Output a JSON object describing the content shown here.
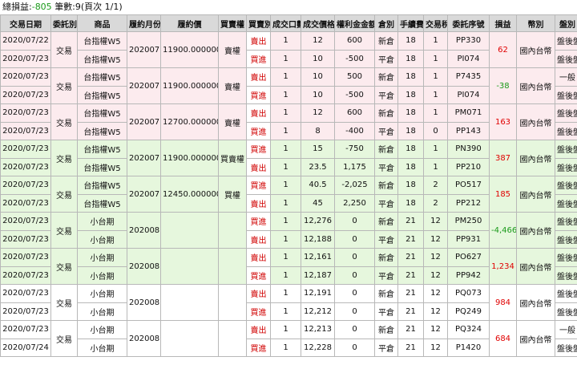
{
  "summary": {
    "pl_label": "總損益:",
    "pl_value": "-805",
    "count_label": "筆數:9(頁次 1/1)"
  },
  "headers": [
    "交易日期",
    "委託別",
    "商品",
    "履約月份",
    "履約價",
    "買賣權",
    "買賣別",
    "成交口數",
    "成交價格",
    "權利金金額",
    "倉別",
    "手續費",
    "交易稅",
    "委託序號",
    "損益",
    "幣別",
    "盤別"
  ],
  "groups": [
    {
      "color": "pink",
      "type": "交易",
      "month": "202007",
      "strike": "11900.000000",
      "cp": "賣權",
      "pl": "62",
      "pl_sign": "pos",
      "currency": "國內台幣",
      "rows": [
        {
          "date": "2020/07/22",
          "product": "台指權W5",
          "bs": "賣出",
          "qty": "1",
          "price": "12",
          "amount": "600",
          "pos": "新倉",
          "fee": "18",
          "tax": "1",
          "order": "PP330",
          "session": "盤後盤"
        },
        {
          "date": "2020/07/23",
          "product": "台指權W5",
          "bs": "買進",
          "qty": "1",
          "price": "10",
          "amount": "-500",
          "pos": "平倉",
          "fee": "18",
          "tax": "1",
          "order": "PI074",
          "session": "盤後盤"
        }
      ]
    },
    {
      "color": "pink",
      "type": "交易",
      "month": "202007",
      "strike": "11900.000000",
      "cp": "賣權",
      "pl": "-38",
      "pl_sign": "neg",
      "currency": "國內台幣",
      "rows": [
        {
          "date": "2020/07/23",
          "product": "台指權W5",
          "bs": "賣出",
          "qty": "1",
          "price": "10",
          "amount": "500",
          "pos": "新倉",
          "fee": "18",
          "tax": "1",
          "order": "P7435",
          "session": "一般"
        },
        {
          "date": "2020/07/23",
          "product": "台指權W5",
          "bs": "買進",
          "qty": "1",
          "price": "10",
          "amount": "-500",
          "pos": "平倉",
          "fee": "18",
          "tax": "1",
          "order": "PI074",
          "session": "盤後盤"
        }
      ]
    },
    {
      "color": "pink",
      "type": "交易",
      "month": "202007",
      "strike": "12700.000000",
      "cp": "賣權",
      "pl": "163",
      "pl_sign": "pos",
      "currency": "國內台幣",
      "rows": [
        {
          "date": "2020/07/23",
          "product": "台指權W5",
          "bs": "賣出",
          "qty": "1",
          "price": "12",
          "amount": "600",
          "pos": "新倉",
          "fee": "18",
          "tax": "1",
          "order": "PM071",
          "session": "盤後盤"
        },
        {
          "date": "2020/07/23",
          "product": "台指權W5",
          "bs": "買進",
          "qty": "1",
          "price": "8",
          "amount": "-400",
          "pos": "平倉",
          "fee": "18",
          "tax": "0",
          "order": "PP143",
          "session": "盤後盤"
        }
      ]
    },
    {
      "color": "green",
      "type": "交易",
      "month": "202007",
      "strike": "11900.000000",
      "cp": "買賣權",
      "pl": "387",
      "pl_sign": "pos",
      "currency": "國內台幣",
      "rows": [
        {
          "date": "2020/07/23",
          "product": "台指權W5",
          "bs": "買進",
          "qty": "1",
          "price": "15",
          "amount": "-750",
          "pos": "新倉",
          "fee": "18",
          "tax": "1",
          "order": "PN390",
          "session": "盤後盤"
        },
        {
          "date": "2020/07/23",
          "product": "台指權W5",
          "bs": "賣出",
          "qty": "1",
          "price": "23.5",
          "amount": "1,175",
          "pos": "平倉",
          "fee": "18",
          "tax": "1",
          "order": "PP210",
          "session": "盤後盤"
        }
      ]
    },
    {
      "color": "green",
      "type": "交易",
      "month": "202007",
      "strike": "12450.000000",
      "cp": "買權",
      "pl": "185",
      "pl_sign": "pos",
      "currency": "國內台幣",
      "rows": [
        {
          "date": "2020/07/23",
          "product": "台指權W5",
          "bs": "買進",
          "qty": "1",
          "price": "40.5",
          "amount": "-2,025",
          "pos": "新倉",
          "fee": "18",
          "tax": "2",
          "order": "PO517",
          "session": "盤後盤"
        },
        {
          "date": "2020/07/23",
          "product": "台指權W5",
          "bs": "賣出",
          "qty": "1",
          "price": "45",
          "amount": "2,250",
          "pos": "平倉",
          "fee": "18",
          "tax": "2",
          "order": "PP212",
          "session": "盤後盤"
        }
      ]
    },
    {
      "color": "green",
      "type": "交易",
      "month": "202008",
      "strike": "",
      "cp": "",
      "pl": "-4,466",
      "pl_sign": "neg",
      "currency": "國內台幣",
      "rows": [
        {
          "date": "2020/07/23",
          "product": "小台期",
          "bs": "買進",
          "qty": "1",
          "price": "12,276",
          "amount": "0",
          "pos": "新倉",
          "fee": "21",
          "tax": "12",
          "order": "PM250",
          "session": "盤後盤"
        },
        {
          "date": "2020/07/23",
          "product": "小台期",
          "bs": "賣出",
          "qty": "1",
          "price": "12,188",
          "amount": "0",
          "pos": "平倉",
          "fee": "21",
          "tax": "12",
          "order": "PP931",
          "session": "盤後盤"
        }
      ]
    },
    {
      "color": "green",
      "type": "交易",
      "month": "202008",
      "strike": "",
      "cp": "",
      "pl": "1,234",
      "pl_sign": "pos",
      "currency": "國內台幣",
      "rows": [
        {
          "date": "2020/07/23",
          "product": "小台期",
          "bs": "賣出",
          "qty": "1",
          "price": "12,161",
          "amount": "0",
          "pos": "新倉",
          "fee": "21",
          "tax": "12",
          "order": "PO627",
          "session": "盤後盤"
        },
        {
          "date": "2020/07/23",
          "product": "小台期",
          "bs": "買進",
          "qty": "1",
          "price": "12,187",
          "amount": "0",
          "pos": "平倉",
          "fee": "21",
          "tax": "12",
          "order": "PP942",
          "session": "盤後盤"
        }
      ]
    },
    {
      "color": "white",
      "type": "交易",
      "month": "202008",
      "strike": "",
      "cp": "",
      "pl": "984",
      "pl_sign": "pos",
      "currency": "國內台幣",
      "rows": [
        {
          "date": "2020/07/23",
          "product": "小台期",
          "bs": "賣出",
          "qty": "1",
          "price": "12,191",
          "amount": "0",
          "pos": "新倉",
          "fee": "21",
          "tax": "12",
          "order": "PQ073",
          "session": "盤後盤"
        },
        {
          "date": "2020/07/23",
          "product": "小台期",
          "bs": "買進",
          "qty": "1",
          "price": "12,212",
          "amount": "0",
          "pos": "平倉",
          "fee": "21",
          "tax": "12",
          "order": "PQ249",
          "session": "盤後盤"
        }
      ]
    },
    {
      "color": "white",
      "type": "交易",
      "month": "202008",
      "strike": "",
      "cp": "",
      "pl": "684",
      "pl_sign": "pos",
      "currency": "國內台幣",
      "rows": [
        {
          "date": "2020/07/23",
          "product": "小台期",
          "bs": "賣出",
          "qty": "1",
          "price": "12,213",
          "amount": "0",
          "pos": "新倉",
          "fee": "21",
          "tax": "12",
          "order": "PQ324",
          "session": "一般"
        },
        {
          "date": "2020/07/24",
          "product": "小台期",
          "bs": "買進",
          "qty": "1",
          "price": "12,228",
          "amount": "0",
          "pos": "平倉",
          "fee": "21",
          "tax": "12",
          "order": "P1420",
          "session": "盤後盤"
        }
      ]
    }
  ]
}
